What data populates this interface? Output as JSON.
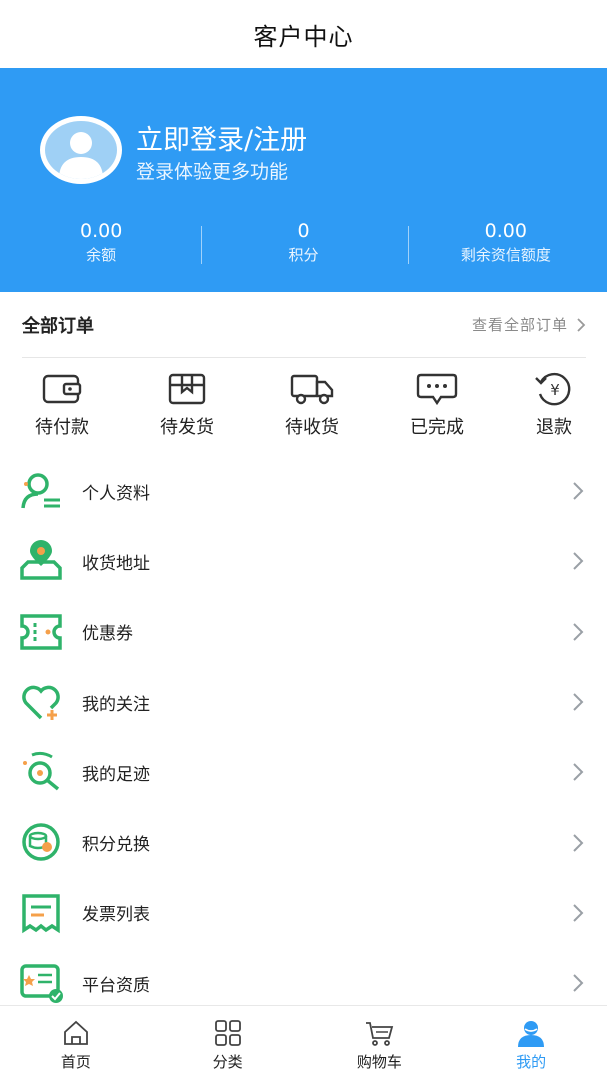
{
  "header": {
    "title": "客户中心"
  },
  "profile": {
    "login_title": "立即登录/注册",
    "login_sub": "登录体验更多功能",
    "stats": [
      {
        "value": "0.00",
        "label": "余额"
      },
      {
        "value": "0",
        "label": "积分"
      },
      {
        "value": "0.00",
        "label": "剩余资信额度"
      }
    ]
  },
  "orders": {
    "heading": "全部订单",
    "view_all": "查看全部订单",
    "items": [
      {
        "label": "待付款",
        "icon": "wallet-icon"
      },
      {
        "label": "待发货",
        "icon": "box-icon"
      },
      {
        "label": "待收货",
        "icon": "truck-icon"
      },
      {
        "label": "已完成",
        "icon": "chat-bubble-icon"
      },
      {
        "label": "退款",
        "icon": "refund-yen-icon"
      }
    ]
  },
  "menu": [
    {
      "label": "个人资料",
      "icon": "profile-card-icon"
    },
    {
      "label": "收货地址",
      "icon": "location-map-icon"
    },
    {
      "label": "优惠券",
      "icon": "coupon-icon"
    },
    {
      "label": "我的关注",
      "icon": "heart-plus-icon"
    },
    {
      "label": "我的足迹",
      "icon": "footprint-icon"
    },
    {
      "label": "积分兑换",
      "icon": "coins-exchange-icon"
    },
    {
      "label": "发票列表",
      "icon": "invoice-icon"
    },
    {
      "label": "平台资质",
      "icon": "certificate-icon"
    }
  ],
  "tabbar": [
    {
      "label": "首页",
      "icon": "home-icon",
      "active": false
    },
    {
      "label": "分类",
      "icon": "grid-icon",
      "active": false
    },
    {
      "label": "购物车",
      "icon": "cart-icon",
      "active": false
    },
    {
      "label": "我的",
      "icon": "user-icon",
      "active": true
    }
  ],
  "colors": {
    "accent": "#2f9bf4",
    "menu_icon_green": "#2fb36a",
    "menu_icon_orange": "#f5a04a"
  }
}
